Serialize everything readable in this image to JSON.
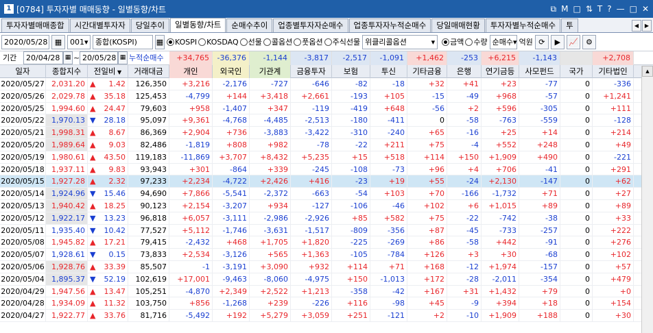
{
  "window": {
    "number": "1",
    "title": "[0784] 투자자별 매매동향 - 일별동향/차트",
    "buttons": [
      "⧉",
      "M",
      "□",
      "⇅",
      "T",
      "?",
      "—",
      "□",
      "✕"
    ]
  },
  "tabs": [
    "투자자별매매종합",
    "시간대별투자자",
    "당일추이",
    "일별동향/차트",
    "순매수추이",
    "업종별투자자순매수",
    "업종투자자누적순매수",
    "당일매매현황",
    "투자자별누적순매수",
    "투"
  ],
  "toolbar": {
    "date": "2020/05/28",
    "code": "001",
    "market": "종합(KOSPI)",
    "radios1": [
      {
        "label": "KOSPI",
        "on": true
      },
      {
        "label": "KOSDAQ",
        "on": false
      },
      {
        "label": "선물",
        "on": false
      },
      {
        "label": "콜옵션",
        "on": false
      },
      {
        "label": "풋옵션",
        "on": false
      },
      {
        "label": "주식선물",
        "on": false
      }
    ],
    "weekly": "위클리콜옵션",
    "radios2": [
      {
        "label": "금액",
        "on": true
      },
      {
        "label": "수량",
        "on": false
      }
    ],
    "mode": "순매수",
    "unit": "억원"
  },
  "summary": {
    "period_label": "기간",
    "from": "20/04/28",
    "tilde": "~",
    "to": "20/05/28",
    "cum_label": "누적순매수",
    "values": [
      "+34,765",
      "-36,376",
      "-1,144",
      "-3,817",
      "-2,517",
      "-1,091",
      "+1,462",
      "-253",
      "+6,215",
      "-1,143",
      "",
      "+2,708"
    ]
  },
  "columns": [
    "일자",
    "종합지수",
    "전일비",
    "거래대금",
    "개인",
    "외국인",
    "기관계",
    "금융투자",
    "보험",
    "투신",
    "기타금융",
    "은행",
    "연기금등",
    "사모펀드",
    "국가",
    "기타법인"
  ],
  "rows": [
    [
      "2020/05/27",
      "2,031.20",
      "up",
      "1.42",
      "126,350",
      "+3,216",
      "-2,176",
      "-727",
      "-646",
      "-82",
      "-18",
      "+32",
      "+41",
      "+23",
      "-77",
      "0",
      "-336"
    ],
    [
      "2020/05/26",
      "2,029.78",
      "up",
      "35.18",
      "125,453",
      "-4,799",
      "+144",
      "+3,418",
      "+2,661",
      "-193",
      "+105",
      "-15",
      "-49",
      "+968",
      "-57",
      "0",
      "+1,241"
    ],
    [
      "2020/05/25",
      "1,994.60",
      "up",
      "24.47",
      "79,603",
      "+958",
      "-1,407",
      "+347",
      "-119",
      "-419",
      "+648",
      "-56",
      "+2",
      "+596",
      "-305",
      "0",
      "+111"
    ],
    [
      "2020/05/22",
      "1,970.13",
      "down",
      "28.18",
      "95,097",
      "+9,361",
      "-4,768",
      "-4,485",
      "-2,513",
      "-180",
      "-411",
      "0",
      "-58",
      "-763",
      "-559",
      "0",
      "-128"
    ],
    [
      "2020/05/21",
      "1,998.31",
      "up",
      "8.67",
      "86,369",
      "+2,904",
      "+736",
      "-3,883",
      "-3,422",
      "-310",
      "-240",
      "+65",
      "-16",
      "+25",
      "+14",
      "0",
      "+214"
    ],
    [
      "2020/05/20",
      "1,989.64",
      "up",
      "9.03",
      "82,486",
      "-1,819",
      "+808",
      "+982",
      "-78",
      "-22",
      "+211",
      "+75",
      "-4",
      "+552",
      "+248",
      "0",
      "+49"
    ],
    [
      "2020/05/19",
      "1,980.61",
      "up",
      "43.50",
      "119,183",
      "-11,869",
      "+3,707",
      "+8,432",
      "+5,235",
      "+15",
      "+518",
      "+114",
      "+150",
      "+1,909",
      "+490",
      "0",
      "-221"
    ],
    [
      "2020/05/18",
      "1,937.11",
      "up",
      "9.83",
      "93,943",
      "+301",
      "-864",
      "+339",
      "-245",
      "-108",
      "-73",
      "+96",
      "+4",
      "+706",
      "-41",
      "0",
      "+291"
    ],
    [
      "2020/05/15",
      "1,927.28",
      "up",
      "2.32",
      "97,233",
      "+2,234",
      "-4,722",
      "+2,426",
      "+416",
      "-23",
      "+19",
      "+55",
      "-24",
      "+2,130",
      "-147",
      "0",
      "+62"
    ],
    [
      "2020/05/14",
      "1,924.96",
      "down",
      "15.46",
      "94,690",
      "+7,866",
      "-5,541",
      "-2,372",
      "-663",
      "-54",
      "+103",
      "+70",
      "-166",
      "-1,732",
      "+71",
      "0",
      "+27"
    ],
    [
      "2020/05/13",
      "1,940.42",
      "up",
      "18.25",
      "90,123",
      "+2,154",
      "-3,207",
      "+934",
      "-127",
      "-106",
      "-46",
      "+102",
      "+6",
      "+1,015",
      "+89",
      "0",
      "+89"
    ],
    [
      "2020/05/12",
      "1,922.17",
      "down",
      "13.23",
      "96,818",
      "+6,057",
      "-3,111",
      "-2,986",
      "-2,926",
      "+85",
      "+582",
      "+75",
      "-22",
      "-742",
      "-38",
      "0",
      "+33"
    ],
    [
      "2020/05/11",
      "1,935.40",
      "down",
      "10.42",
      "77,527",
      "+5,112",
      "-1,746",
      "-3,631",
      "-1,517",
      "-809",
      "-356",
      "+87",
      "-45",
      "-733",
      "-257",
      "0",
      "+222"
    ],
    [
      "2020/05/08",
      "1,945.82",
      "up",
      "17.21",
      "79,415",
      "-2,432",
      "+468",
      "+1,705",
      "+1,820",
      "-225",
      "-269",
      "+86",
      "-58",
      "+442",
      "-91",
      "0",
      "+276"
    ],
    [
      "2020/05/07",
      "1,928.61",
      "down",
      "0.15",
      "73,833",
      "+2,534",
      "-3,126",
      "+565",
      "+1,363",
      "-105",
      "-784",
      "+126",
      "+3",
      "+30",
      "-68",
      "0",
      "+102"
    ],
    [
      "2020/05/06",
      "1,928.76",
      "up",
      "33.39",
      "85,507",
      "-1",
      "-3,191",
      "+3,090",
      "+932",
      "+114",
      "+71",
      "+168",
      "-12",
      "+1,974",
      "-157",
      "0",
      "+57"
    ],
    [
      "2020/05/04",
      "1,895.37",
      "down",
      "52.19",
      "102,619",
      "+17,001",
      "-9,463",
      "-8,060",
      "-4,975",
      "+150",
      "-1,013",
      "+172",
      "-28",
      "-2,011",
      "-354",
      "0",
      "+479"
    ],
    [
      "2020/04/29",
      "1,947.56",
      "up",
      "13.47",
      "105,251",
      "-4,870",
      "+2,349",
      "+2,522",
      "+1,213",
      "-358",
      "-42",
      "+167",
      "+31",
      "+1,432",
      "+79",
      "0",
      "+0"
    ],
    [
      "2020/04/28",
      "1,934.09",
      "up",
      "11.32",
      "103,750",
      "+856",
      "-1,268",
      "+239",
      "-226",
      "+116",
      "-98",
      "+45",
      "-9",
      "+394",
      "+18",
      "0",
      "+154"
    ],
    [
      "2020/04/27",
      "1,922.77",
      "up",
      "33.76",
      "81,716",
      "-5,492",
      "+192",
      "+5,279",
      "+3,059",
      "+251",
      "-121",
      "+2",
      "-10",
      "+1,909",
      "+188",
      "0",
      "+30"
    ]
  ],
  "highlight_row": "2020/05/15",
  "colors": {
    "up": "#e8262b",
    "down": "#1a3fd1",
    "titlebar": "#1f5fa8",
    "highlight": "#cfe6f5"
  }
}
